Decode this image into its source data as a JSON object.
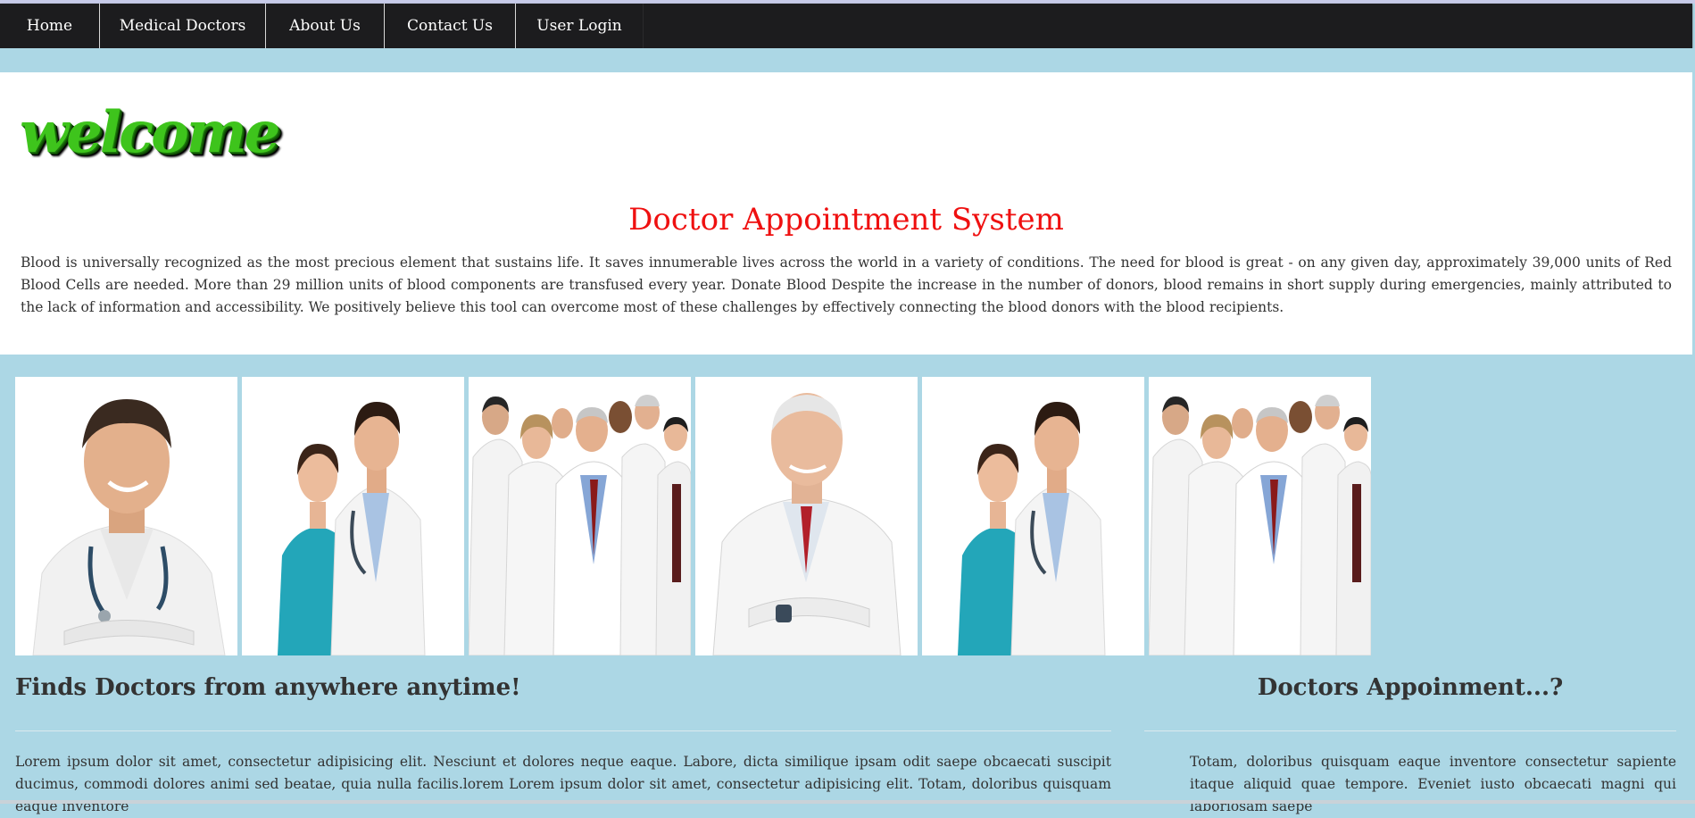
{
  "nav": {
    "items": [
      {
        "label": "Home"
      },
      {
        "label": "Medical Doctors"
      },
      {
        "label": "About Us"
      },
      {
        "label": "Contact Us"
      },
      {
        "label": "User Login"
      }
    ]
  },
  "welcome": {
    "logo_text": "welcome",
    "title": "Doctor Appointment System",
    "intro": "Blood is universally recognized as the most precious element that sustains life. It saves innumerable lives across the world in a variety of conditions. The need for blood is great - on any given day, approximately 39,000 units of Red Blood Cells are needed. More than 29 million units of blood components are transfused every year. Donate Blood Despite the increase in the number of donors, blood remains in short supply during emergencies, mainly attributed to the lack of information and accessibility. We positively believe this tool can overcome most of these challenges by effectively connecting the blood donors with the blood recipients."
  },
  "gallery": {
    "photos": [
      {
        "subject": "smiling male doctor with stethoscope"
      },
      {
        "subject": "female nurse and male doctor"
      },
      {
        "subject": "group of doctors"
      },
      {
        "subject": "senior doctor in white coat"
      },
      {
        "subject": "female nurse and male doctor"
      },
      {
        "subject": "group of doctors"
      }
    ]
  },
  "sections": {
    "left": {
      "heading": "Finds Doctors from anywhere anytime!",
      "body": "Lorem ipsum dolor sit amet, consectetur adipisicing elit. Nesciunt et dolores neque eaque. Labore, dicta similique ipsam odit saepe obcaecati suscipit ducimus, commodi dolores animi sed beatae, quia nulla facilis.lorem Lorem ipsum dolor sit amet, consectetur adipisicing elit. Totam, doloribus quisquam eaque inventore"
    },
    "right": {
      "heading": "Doctors Appoinment...?",
      "body": "Totam, doloribus quisquam eaque inventore consectetur sapiente itaque aliquid quae tempore. Eveniet iusto obcaecati magni qui laboriosam saepe"
    }
  },
  "colors": {
    "nav_bg": "#1c1c1e",
    "page_bg": "#acd7e5",
    "title_red": "#ef1010",
    "welcome_green": "#3ec41c"
  }
}
